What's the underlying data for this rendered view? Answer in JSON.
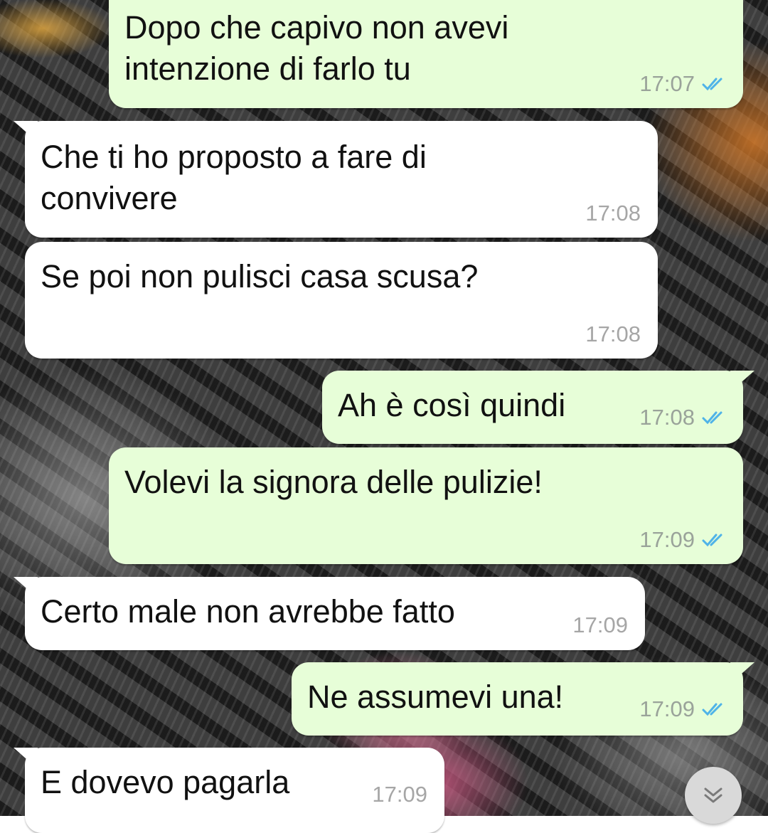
{
  "chat": {
    "messages": [
      {
        "direction": "outgoing",
        "text": "Dopo che capivo non avevi\nintenzione di farlo tu",
        "time": "17:07",
        "status": "read"
      },
      {
        "direction": "incoming",
        "text": "Che ti ho proposto a fare di\nconvivere",
        "time": "17:08"
      },
      {
        "direction": "incoming",
        "text": "Se poi non pulisci casa scusa?",
        "time": "17:08"
      },
      {
        "direction": "outgoing",
        "text": "Ah è così quindi",
        "time": "17:08",
        "status": "read"
      },
      {
        "direction": "outgoing",
        "text": "Volevi la signora delle pulizie!",
        "time": "17:09",
        "status": "read"
      },
      {
        "direction": "incoming",
        "text": "Certo male non avrebbe fatto",
        "time": "17:09"
      },
      {
        "direction": "outgoing",
        "text": "Ne assumevi una!",
        "time": "17:09",
        "status": "read"
      },
      {
        "direction": "incoming",
        "text": "E dovevo pagarla",
        "time": "17:09"
      }
    ],
    "scroll_button_icon": "double-chevron-down-icon"
  },
  "colors": {
    "outgoing_bubble": "#e7fed8",
    "incoming_bubble": "#ffffff",
    "read_receipt": "#4fb3e8",
    "timestamp": "#9aa39a"
  },
  "icons": {
    "read_receipt": "double-check-icon"
  }
}
